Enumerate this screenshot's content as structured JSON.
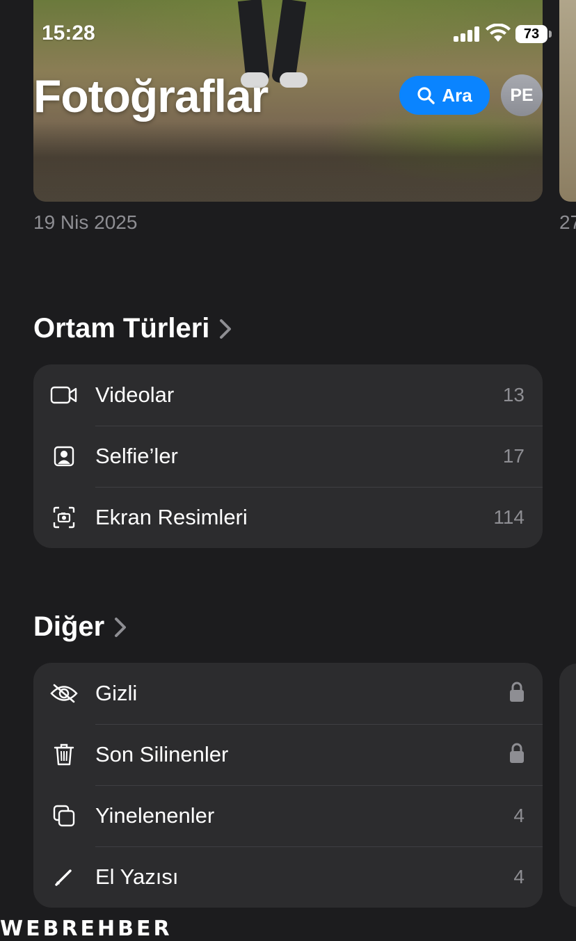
{
  "status_bar": {
    "time": "15:28",
    "battery": "73"
  },
  "header": {
    "title": "Fotoğraflar",
    "search_label": "Ara",
    "avatar_initials": "PE"
  },
  "hero": {
    "date": "19 Nis 2025",
    "next_date": "27"
  },
  "media_types": {
    "title": "Ortam Türleri",
    "items": [
      {
        "label": "Videolar",
        "count": "13",
        "icon": "video-icon"
      },
      {
        "label": "Selfie’ler",
        "count": "17",
        "icon": "selfie-icon"
      },
      {
        "label": "Ekran Resimleri",
        "count": "114",
        "icon": "screenshot-icon"
      }
    ]
  },
  "other": {
    "title": "Diğer",
    "items": [
      {
        "label": "Gizli",
        "icon": "hidden-eye-icon",
        "locked": true
      },
      {
        "label": "Son Silinenler",
        "icon": "trash-icon",
        "locked": true
      },
      {
        "label": "Yinelenenler",
        "count": "4",
        "icon": "duplicates-icon"
      },
      {
        "label": "El Yazısı",
        "count": "4",
        "icon": "pencil-icon"
      }
    ]
  },
  "watermark": "WEBREHBER",
  "colors": {
    "background": "#1c1c1e",
    "card": "#2c2c2e",
    "accent": "#0a84ff",
    "secondary_text": "#8e8e93"
  }
}
